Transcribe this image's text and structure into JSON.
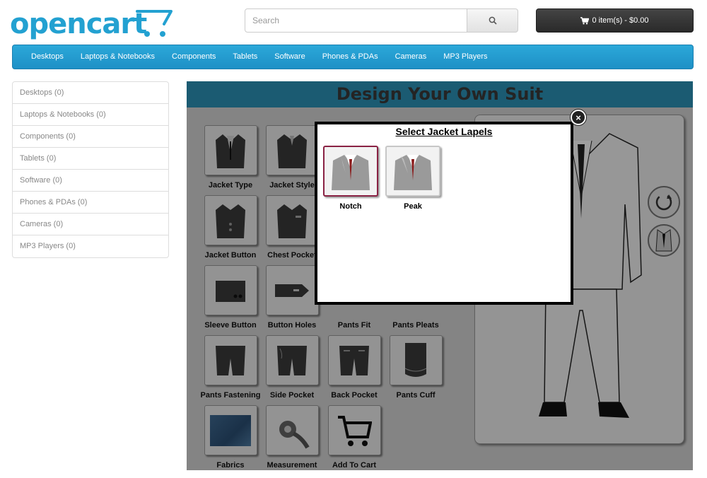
{
  "brand": {
    "logo_text": "opencart",
    "accent": "#23a1d1"
  },
  "search": {
    "placeholder": "Search",
    "icon": "search-icon"
  },
  "cart": {
    "icon": "cart-icon",
    "label": "0 item(s) - $0.00"
  },
  "nav": {
    "items": [
      "Desktops",
      "Laptops & Notebooks",
      "Components",
      "Tablets",
      "Software",
      "Phones & PDAs",
      "Cameras",
      "MP3 Players"
    ]
  },
  "sidebar": {
    "items": [
      "Desktops (0)",
      "Laptops & Notebooks (0)",
      "Components (0)",
      "Tablets (0)",
      "Software (0)",
      "Phones & PDAs (0)",
      "Cameras (0)",
      "MP3 Players (0)"
    ]
  },
  "designer": {
    "title": "Design Your Own Suit",
    "options": {
      "jacket_type": "Jacket Type",
      "jacket_style": "Jacket Style",
      "jacket_button": "Jacket Button",
      "chest_pocket": "Chest Pocket",
      "sleeve_button": "Sleeve Button",
      "button_holes": "Button Holes",
      "pants_fit": "Pants Fit",
      "pants_pleats": "Pants Pleats",
      "pants_fastening": "Pants Fastening",
      "side_pocket": "Side Pocket",
      "back_pocket": "Back Pocket",
      "pants_cuff": "Pants Cuff",
      "fabrics": "Fabrics",
      "measurement": "Measurement",
      "add_to_cart": "Add To Cart"
    }
  },
  "modal": {
    "title": "Select Jacket Lapels",
    "close_icon": "close-icon",
    "lapels": [
      "Notch",
      "Peak"
    ],
    "selected": "Notch",
    "selected_color": "#8a2244"
  }
}
